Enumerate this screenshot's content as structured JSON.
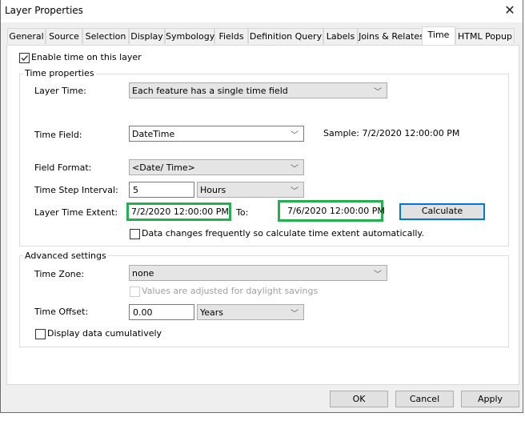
{
  "window": {
    "title": "Layer Properties",
    "close_icon": "close-icon"
  },
  "tabs": [
    {
      "label": "General"
    },
    {
      "label": "Source"
    },
    {
      "label": "Selection"
    },
    {
      "label": "Display"
    },
    {
      "label": "Symbology"
    },
    {
      "label": "Fields"
    },
    {
      "label": "Definition Query"
    },
    {
      "label": "Labels"
    },
    {
      "label": "Joins & Relates"
    },
    {
      "label": "Time",
      "active": true
    },
    {
      "label": "HTML Popup"
    }
  ],
  "enable_time": {
    "label": "Enable time on this layer",
    "checked": true
  },
  "time_properties": {
    "group_label": "Time properties",
    "layer_time_label": "Layer Time:",
    "layer_time_value": "Each feature has a single time field",
    "time_field_label": "Time Field:",
    "time_field_value": "DateTime",
    "sample_text": "Sample: 7/2/2020 12:00:00 PM",
    "field_format_label": "Field Format:",
    "field_format_value": "<Date/ Time>",
    "time_step_label": "Time Step Interval:",
    "time_step_value": "5",
    "time_step_units": "Hours",
    "extent_label": "Layer Time Extent:",
    "extent_start": "7/2/2020 12:00:00 PM",
    "to_label": "To:",
    "extent_end": "7/6/2020 12:00:00 PM",
    "calculate_label": "Calculate",
    "auto_calc_label": "Data changes frequently so calculate time extent automatically.",
    "auto_calc_checked": false,
    "highlight_color": "#22b14c"
  },
  "advanced": {
    "group_label": "Advanced settings",
    "time_zone_label": "Time Zone:",
    "time_zone_value": "none",
    "dst_label": "Values are adjusted for daylight savings",
    "dst_checked": false,
    "time_offset_label": "Time Offset:",
    "time_offset_value": "0.00",
    "time_offset_units": "Years",
    "cumulative_label": "Display data cumulatively",
    "cumulative_checked": false
  },
  "footer": {
    "ok_label": "OK",
    "cancel_label": "Cancel",
    "apply_label": "Apply"
  }
}
